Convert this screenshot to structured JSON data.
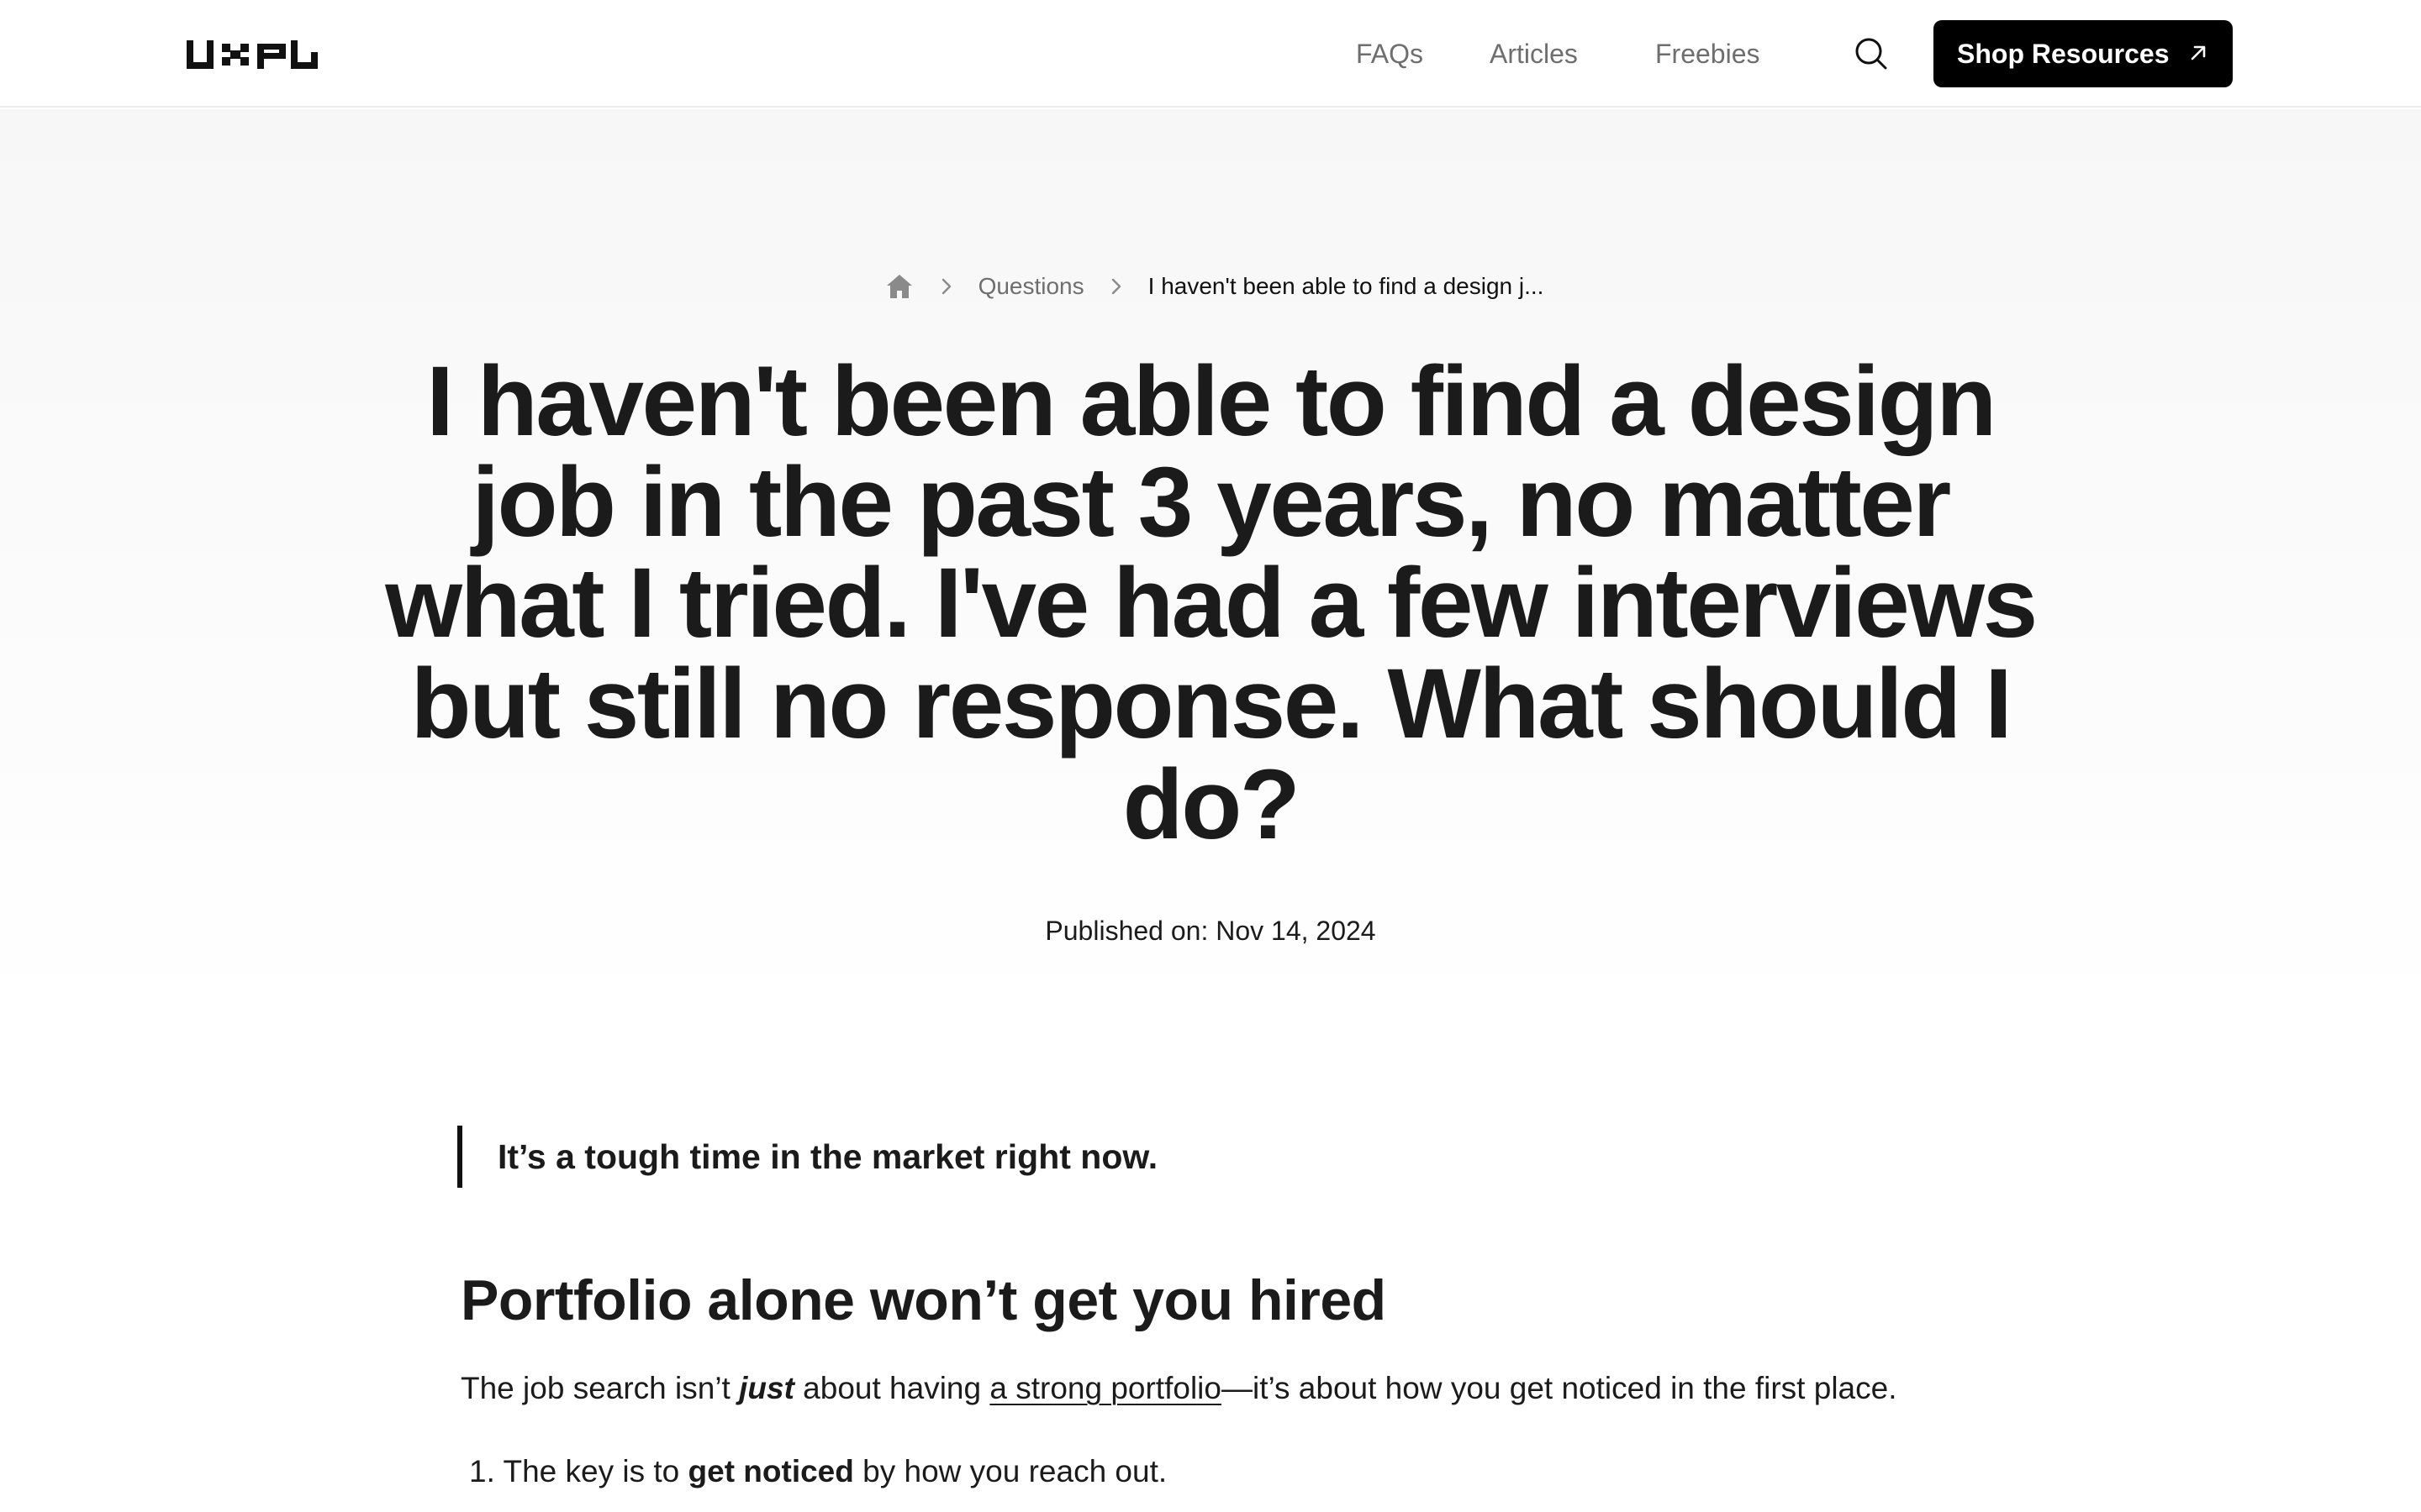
{
  "header": {
    "logo_text": "uxpl",
    "nav": [
      {
        "label": "FAQs"
      },
      {
        "label": "Articles"
      },
      {
        "label": "Freebies"
      }
    ],
    "search_icon": "search-icon",
    "cta_label": "Shop Resources",
    "cta_icon": "arrow-up-right-icon"
  },
  "breadcrumb": {
    "home_icon": "home-icon",
    "separator_icon": "chevron-right-icon",
    "parent": "Questions",
    "current": "I haven't been able to find a design j..."
  },
  "article": {
    "title": "I haven't been able to find a design job in the past 3 years, no matter what I tried. I've had a few interviews but still no response. What should I do?",
    "published_label": "Published on:",
    "published_date": "Nov 14, 2024",
    "callout": "It’s a tough time in the market right now.",
    "section_heading": "Portfolio alone won’t get you hired",
    "paragraph": {
      "before_emphasis": "The job search isn’t ",
      "emphasis": "just",
      "after_emphasis": " about having ",
      "link_text": "a strong portfolio",
      "after_link": "—it’s about how you get noticed in the first place."
    },
    "list_items": [
      {
        "number": "1.",
        "before": "The key is to ",
        "bold": "get noticed",
        "after": " by how you reach out."
      }
    ]
  },
  "colors": {
    "text": "#1b1b1b",
    "muted": "#6e6e6e",
    "cta_background": "#000000",
    "cta_text": "#ffffff",
    "hero_background": "#f7f7f7"
  }
}
